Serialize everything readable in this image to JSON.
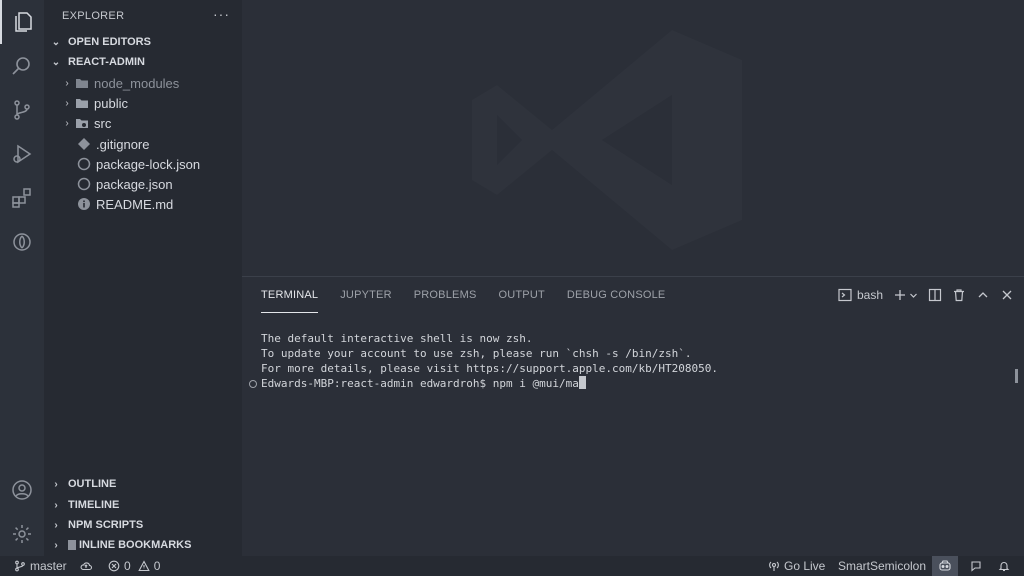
{
  "sidebar": {
    "title": "EXPLORER",
    "menu_icon": "ellipsis-icon",
    "sections": {
      "open_editors": "OPEN EDITORS",
      "project": "REACT-ADMIN",
      "outline": "OUTLINE",
      "timeline": "TIMELINE",
      "npm_scripts": "NPM SCRIPTS",
      "inline_bookmarks": "INLINE BOOKMARKS"
    },
    "tree": [
      {
        "label": "node_modules",
        "kind": "folder",
        "muted": true
      },
      {
        "label": "public",
        "kind": "folder"
      },
      {
        "label": "src",
        "kind": "folder"
      },
      {
        "label": ".gitignore",
        "kind": "file"
      },
      {
        "label": "package-lock.json",
        "kind": "file"
      },
      {
        "label": "package.json",
        "kind": "file"
      },
      {
        "label": "README.md",
        "kind": "file"
      }
    ]
  },
  "panel": {
    "tabs": [
      "TERMINAL",
      "JUPYTER",
      "PROBLEMS",
      "OUTPUT",
      "DEBUG CONSOLE"
    ],
    "active_tab": "TERMINAL",
    "shell": "bash",
    "terminal_lines": [
      "The default interactive shell is now zsh.",
      "To update your account to use zsh, please run `chsh -s /bin/zsh`.",
      "For more details, please visit https://support.apple.com/kb/HT208050.",
      "Edwards-MBP:react-admin edwardroh$ npm i @mui/ma"
    ]
  },
  "status": {
    "branch": "master",
    "errors": "0",
    "warnings": "0",
    "go_live": "Go Live",
    "smart_semicolon": "SmartSemicolon"
  },
  "colors": {
    "accent": "#d7dae0",
    "activity_bg": "#2c313a",
    "sidebar_bg": "#262a32",
    "editor_bg": "#2b2f38"
  }
}
